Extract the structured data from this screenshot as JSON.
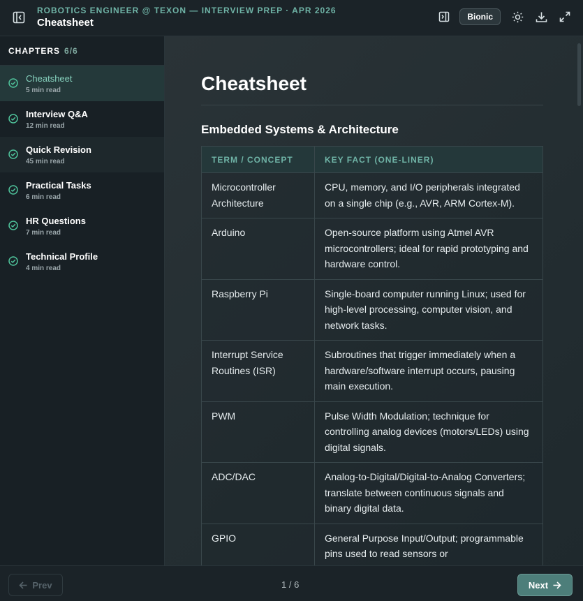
{
  "header": {
    "subtitle": "ROBOTICS ENGINEER @ TEXON — INTERVIEW PREP · APR 2026",
    "title": "Cheatsheet",
    "bionic_label": "Bionic"
  },
  "sidebar": {
    "heading": "CHAPTERS",
    "count": "6/6",
    "chapters": [
      {
        "title": "Cheatsheet",
        "time": "5 min read"
      },
      {
        "title": "Interview Q&A",
        "time": "12 min read"
      },
      {
        "title": "Quick Revision",
        "time": "45 min read"
      },
      {
        "title": "Practical Tasks",
        "time": "6 min read"
      },
      {
        "title": "HR Questions",
        "time": "7 min read"
      },
      {
        "title": "Technical Profile",
        "time": "4 min read"
      }
    ]
  },
  "main": {
    "title": "Cheatsheet",
    "section": "Embedded Systems & Architecture",
    "columns": [
      "TERM / CONCEPT",
      "KEY FACT (ONE-LINER)"
    ],
    "rows": [
      {
        "term": "Microcontroller Architecture",
        "fact": "CPU, memory, and I/O peripherals integrated on a single chip (e.g., AVR, ARM Cortex-M)."
      },
      {
        "term": "Arduino",
        "fact": "Open-source platform using Atmel AVR microcontrollers; ideal for rapid prototyping and hardware control."
      },
      {
        "term": "Raspberry Pi",
        "fact": "Single-board computer running Linux; used for high-level processing, computer vision, and network tasks."
      },
      {
        "term": "Interrupt Service Routines (ISR)",
        "fact": "Subroutines that trigger immediately when a hardware/software interrupt occurs, pausing main execution."
      },
      {
        "term": "PWM",
        "fact": "Pulse Width Modulation; technique for controlling analog devices (motors/LEDs) using digital signals."
      },
      {
        "term": "ADC/DAC",
        "fact": "Analog-to-Digital/Digital-to-Analog Converters; translate between continuous signals and binary digital data."
      },
      {
        "term": "GPIO",
        "fact": "General Purpose Input/Output; programmable pins used to read sensors or"
      }
    ]
  },
  "footer": {
    "prev_label": "Prev",
    "page_indicator": "1 / 6",
    "next_label": "Next"
  }
}
